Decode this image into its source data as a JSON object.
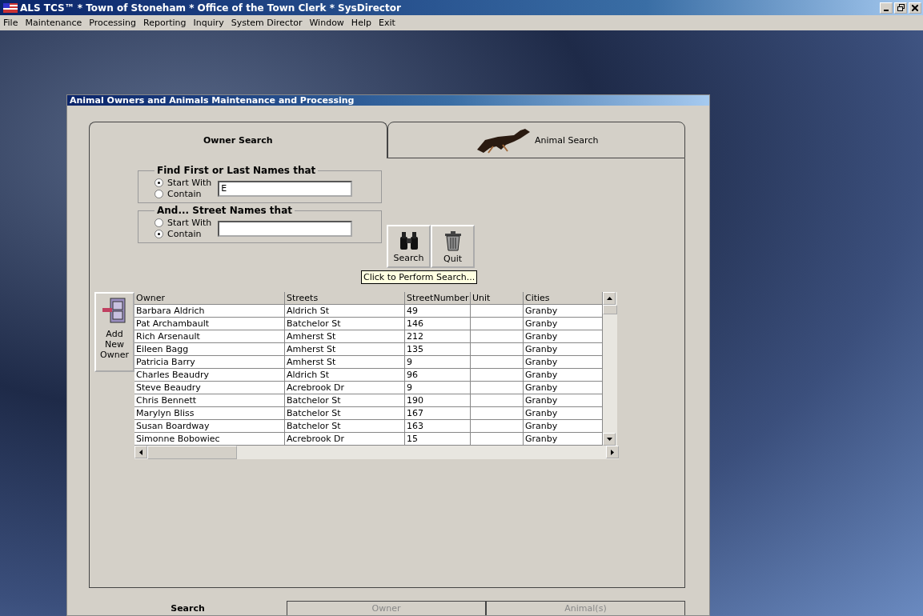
{
  "window": {
    "title": "ALS TCS™ * Town of Stoneham * Office of the Town Clerk * SysDirector"
  },
  "menu": [
    "File",
    "Maintenance",
    "Processing",
    "Reporting",
    "Inquiry",
    "System Director",
    "Window",
    "Help",
    "Exit"
  ],
  "child_window": {
    "title": "Animal Owners and Animals Maintenance and Processing"
  },
  "tabs": [
    {
      "label": "Owner Search",
      "selected": true
    },
    {
      "label": "Animal Search",
      "selected": false
    }
  ],
  "name_filter": {
    "legend": "Find First or Last Names that",
    "options": [
      {
        "label": "Start With",
        "selected": true
      },
      {
        "label": "Contain",
        "selected": false
      }
    ],
    "value": "E"
  },
  "street_filter": {
    "legend": "And... Street Names that",
    "options": [
      {
        "label": "Start With",
        "selected": false
      },
      {
        "label": "Contain",
        "selected": true
      }
    ]
  },
  "buttons": [
    {
      "kind": "search",
      "label": "Search"
    },
    {
      "kind": "quit",
      "label": "Quit"
    }
  ],
  "tooltip": "Click to Perform Search...",
  "add_button": {
    "label": "Add New Owner"
  },
  "table": {
    "columns": [
      "Owner",
      "Streets",
      "StreetNumber",
      "Unit",
      "Cities"
    ],
    "rows": [
      [
        "Barbara Aldrich",
        "Aldrich St",
        "49",
        "",
        "Granby"
      ],
      [
        "Pat Archambault",
        "Batchelor St",
        "146",
        "",
        "Granby"
      ],
      [
        "Rich Arsenault",
        "Amherst St",
        "212",
        "",
        "Granby"
      ],
      [
        "Eileen Bagg",
        "Amherst St",
        "135",
        "",
        "Granby"
      ],
      [
        "Patricia Barry",
        "Amherst St",
        "9",
        "",
        "Granby"
      ],
      [
        "Charles  Beaudry",
        "Aldrich St",
        "96",
        "",
        "Granby"
      ],
      [
        "Steve Beaudry",
        "Acrebrook Dr",
        "9",
        "",
        "Granby"
      ],
      [
        "Chris Bennett",
        "Batchelor St",
        "190",
        "",
        "Granby"
      ],
      [
        "Marylyn Bliss",
        "Batchelor St",
        "167",
        "",
        "Granby"
      ],
      [
        "Susan Boardway",
        "Batchelor St",
        "163",
        "",
        "Granby"
      ],
      [
        "Simonne Bobowiec",
        "Acrebrook Dr",
        "15",
        "",
        "Granby"
      ]
    ]
  },
  "bottom_tabs": [
    {
      "label": "Search",
      "selected": true,
      "disabled": false
    },
    {
      "label": "Owner",
      "selected": false,
      "disabled": true
    },
    {
      "label": "Animal(s)",
      "selected": false,
      "disabled": true
    }
  ]
}
